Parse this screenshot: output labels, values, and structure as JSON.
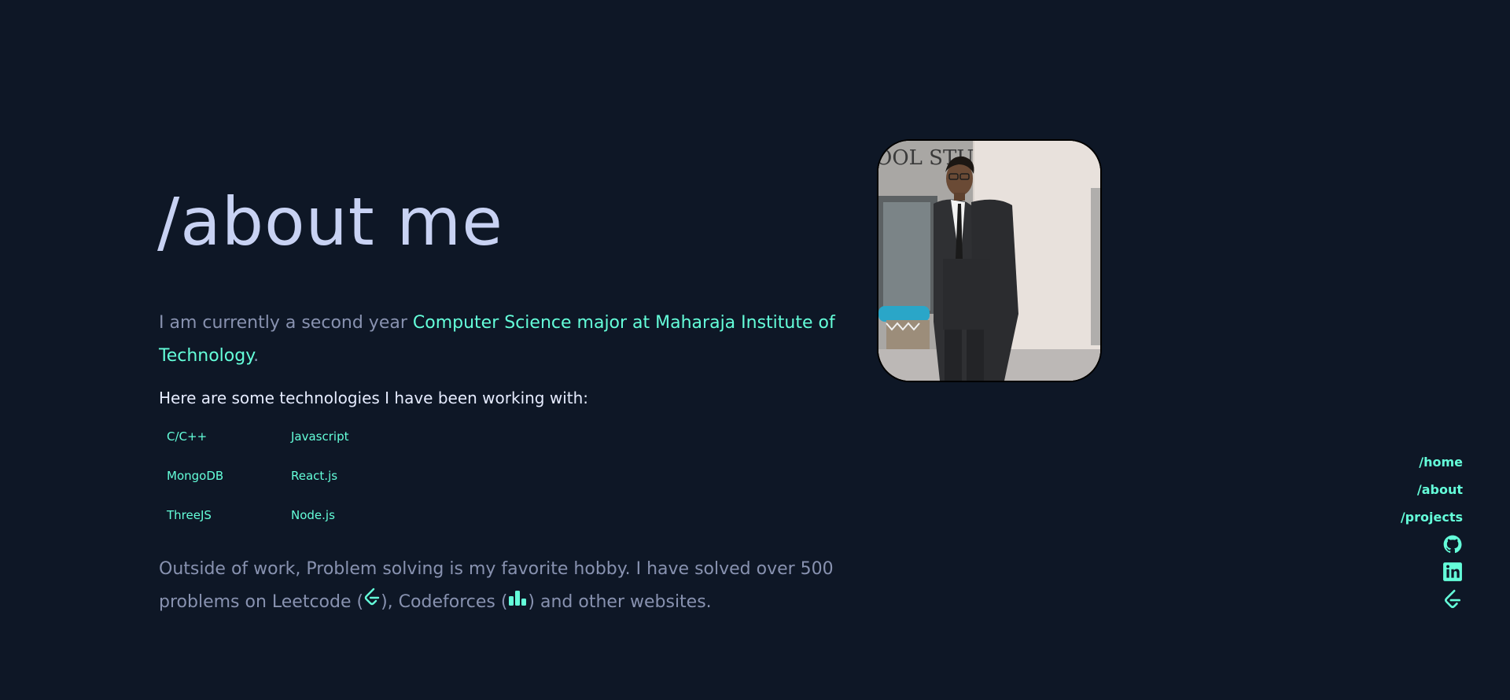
{
  "about": {
    "title": "/about me",
    "intro_prefix": "I am currently a second year ",
    "intro_highlight": "Computer Science major at Maharaja Institute of Technology",
    "intro_suffix": ".",
    "tech_intro": "Here are some technologies I have been working with:",
    "technologies": [
      "C/C++",
      "Javascript",
      "MongoDB",
      "React.js",
      "ThreeJS",
      "Node.js"
    ],
    "outro_part1": "Outside of work, Problem solving is my favorite hobby. I have solved over 500 problems on Leetcode (",
    "outro_part2": "), Codeforces (",
    "outro_part3": ") and other websites."
  },
  "photo": {
    "sign_text": "OOL STU"
  },
  "side_nav": {
    "links": [
      "/home",
      "/about",
      "/projects"
    ],
    "icons": [
      "github-icon",
      "linkedin-icon",
      "leetcode-icon"
    ]
  },
  "colors": {
    "background": "#0e1726",
    "accent": "#64ffda",
    "heading": "#c8d2f3",
    "body_text": "#8892b0"
  }
}
